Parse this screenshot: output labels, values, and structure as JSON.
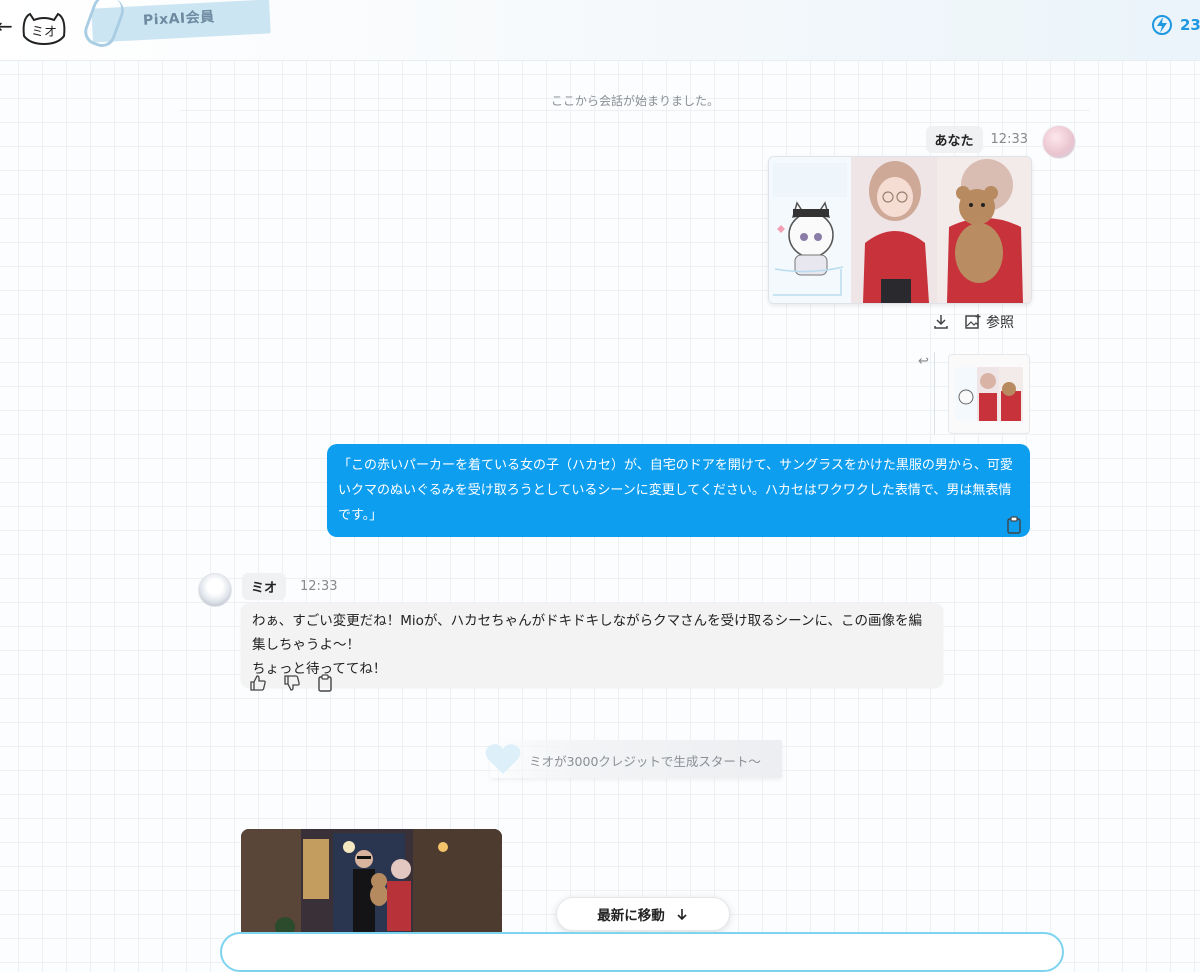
{
  "header": {
    "back_icon": "arrow-left-icon",
    "logo_text": "ミオ",
    "membership_label": "PixAI会員",
    "credits_text": "23",
    "credits_icon": "lightning-icon"
  },
  "chat": {
    "system_message": "ここから会話が始まりました。",
    "user_message": {
      "sender": "あなた",
      "time": "12:33",
      "reference_label": "参照",
      "text": "「この赤いパーカーを着ている女の子（ハカセ）が、自宅のドアを開けて、サングラスをかけた黒服の男から、可愛いクマのぬいぐるみを受け取ろうとしているシーンに変更してください。ハカセはワクワクした表情で、男は無表情です。」"
    },
    "bot_message": {
      "sender": "ミオ",
      "time": "12:33",
      "text_line1": "わぁ、すごい変更だね！Mioが、ハカセちゃんがドキドキしながらクマさんを受け取るシーンに、この画像を編集しちゃうよ〜！",
      "text_line2": "ちょっと待っててね！"
    },
    "generation_status": "ミオが3000クレジットで生成スタート〜",
    "jump_button_label": "最新に移動"
  },
  "colors": {
    "user_bubble": "#0d9ef0",
    "accent": "#1e98e0",
    "input_border": "#7ed3ee"
  }
}
